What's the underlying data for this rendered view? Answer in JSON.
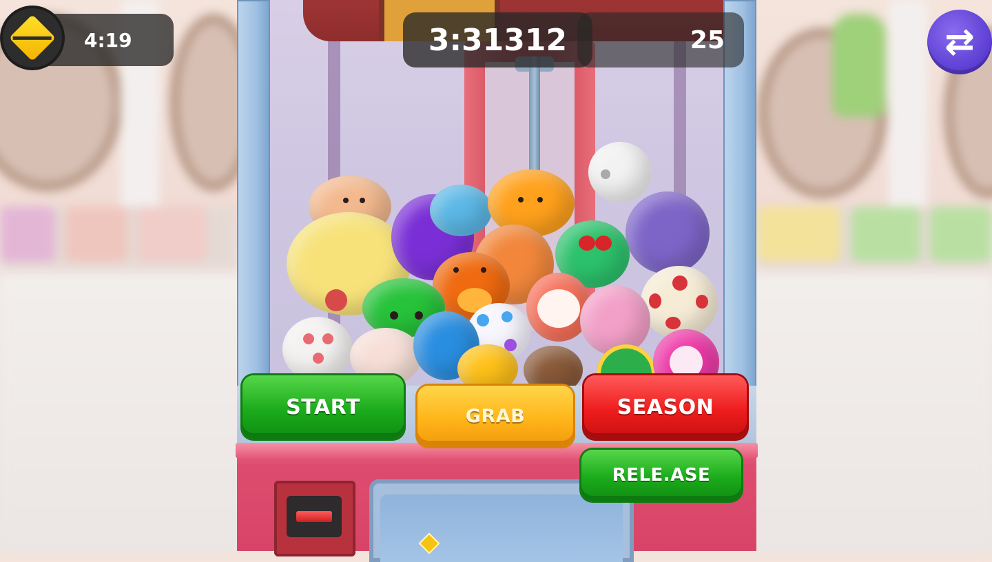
{
  "hud": {
    "left_timer": "4:19",
    "center_timer": "3:31312",
    "count": "25",
    "coin_icon": "gold-diamond-icon",
    "swap_icon": "swap-arrows-icon",
    "swap_glyph": "⇄"
  },
  "buttons": {
    "start": "START",
    "grab": "GRAB",
    "season": "SEASON",
    "release": "RELE.ASE"
  },
  "colors": {
    "start_green": "#1bab1b",
    "grab_orange": "#ffb51a",
    "season_red": "#ee1d1d",
    "swap_purple": "#5a3cd1",
    "machine_pink": "#dd4c6e",
    "frame_blue": "#9ec0e2"
  }
}
